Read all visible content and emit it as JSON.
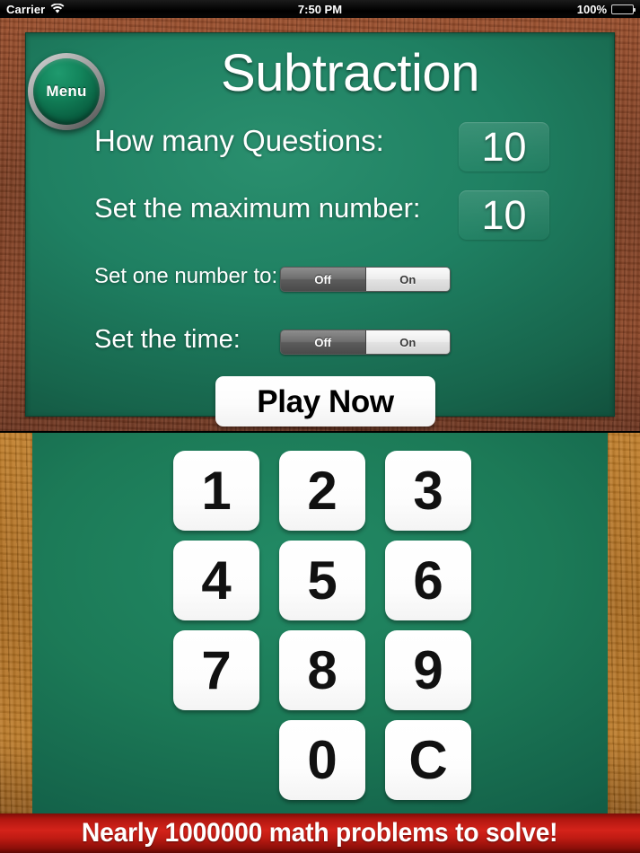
{
  "status_bar": {
    "carrier": "Carrier",
    "wifi_icon": "wifi-icon",
    "time": "7:50 PM",
    "battery_percent": "100%",
    "battery_icon": "battery-full-icon"
  },
  "top_panel": {
    "menu_button_label": "Menu",
    "title": "Subtraction",
    "settings": [
      {
        "label": "How many Questions:",
        "control": "stepper-value",
        "value": "10"
      },
      {
        "label": "Set the maximum number:",
        "control": "stepper-value",
        "value": "10"
      },
      {
        "label": "Set one number to:",
        "control": "segmented",
        "options": [
          "Off",
          "On"
        ],
        "selected": "Off"
      },
      {
        "label": "Set the time:",
        "control": "segmented",
        "options": [
          "Off",
          "On"
        ],
        "selected": "Off"
      }
    ],
    "play_button_label": "Play Now"
  },
  "keypad": {
    "keys": [
      "1",
      "2",
      "3",
      "4",
      "5",
      "6",
      "7",
      "8",
      "9",
      "",
      "0",
      "C"
    ]
  },
  "ad_banner": {
    "text": "Nearly 1000000 math problems to solve!"
  },
  "colors": {
    "chalkboard_green": "#1c7a57",
    "frame_wood_dark": "#8a4628",
    "frame_wood_light": "#b5741f",
    "ad_red": "#d4231a",
    "key_white": "#ffffff",
    "toggle_selected": "#6e6e6e"
  }
}
